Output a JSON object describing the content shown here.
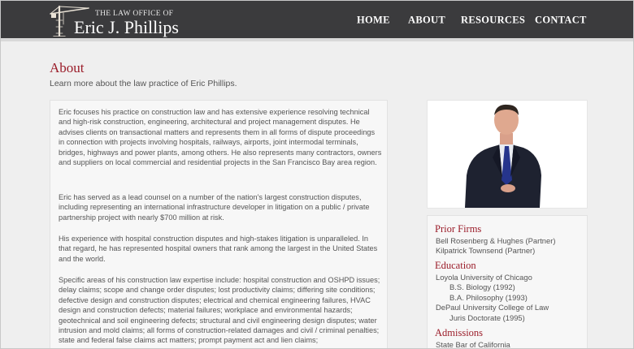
{
  "header": {
    "logo_small": "THE LAW OFFICE OF",
    "logo_name": "Eric J. Phillips",
    "nav": [
      "HOME",
      "ABOUT",
      "RESOURCES",
      "CONTACT"
    ]
  },
  "page": {
    "title": "About",
    "subtitle": "Learn more about the law practice of Eric Phillips."
  },
  "content": {
    "paragraphs": [
      "Eric focuses his practice on construction law and has extensive experience resolving technical and high-risk construction, engineering, architectural and project management disputes. He advises clients on transactional matters and represents them in all forms of dispute proceedings in connection with projects involving hospitals, railways, airports, joint intermodal terminals, bridges, highways and power plants, among others. He also represents many contractors, owners and suppliers on local commercial and residential projects in the San Francisco Bay area region.",
      "Eric has served as a lead counsel on a number of the nation's largest construction disputes, including representing an international infrastructure developer in litigation on a public / private partnership project with nearly $700 million at risk.",
      "His experience with hospital construction disputes and high-stakes litigation is unparalleled. In that regard, he has represented hospital owners that rank among the largest in the United States and the world.",
      "Specific areas of his construction law expertise include: hospital construction and OSHPD issues; delay claims; scope and change order disputes; lost productivity claims; differing site conditions; defective design and construction disputes; electrical and chemical engineering failures, HVAC design and construction defects; material failures; workplace and environmental hazards; geotechnical and soil engineering defects; structural and civil engineering design disputes; water intrusion and mold claims; all forms of construction-related damages and civil / criminal penalties; state and federal false claims act matters; prompt payment act and lien claims;"
    ]
  },
  "sidebar": {
    "prior_firms_heading": "Prior Firms",
    "prior_firms": [
      "Bell Rosenberg & Hughes (Partner)",
      "Kilpatrick Townsend (Partner)"
    ],
    "education_heading": "Education",
    "education": [
      "Loyola University of Chicago",
      "B.S. Biology (1992)",
      "B.A. Philosophy (1993)",
      "DePaul University College of Law",
      "Juris Doctorate (1995)"
    ],
    "admissions_heading": "Admissions",
    "admissions": [
      "State Bar of California"
    ]
  },
  "colors": {
    "header_bg": "#3b3b3d",
    "accent": "#9b1d2a",
    "page_bg": "#efefef"
  },
  "icons": {
    "logo": "crane-icon",
    "portrait": "attorney-portrait"
  }
}
